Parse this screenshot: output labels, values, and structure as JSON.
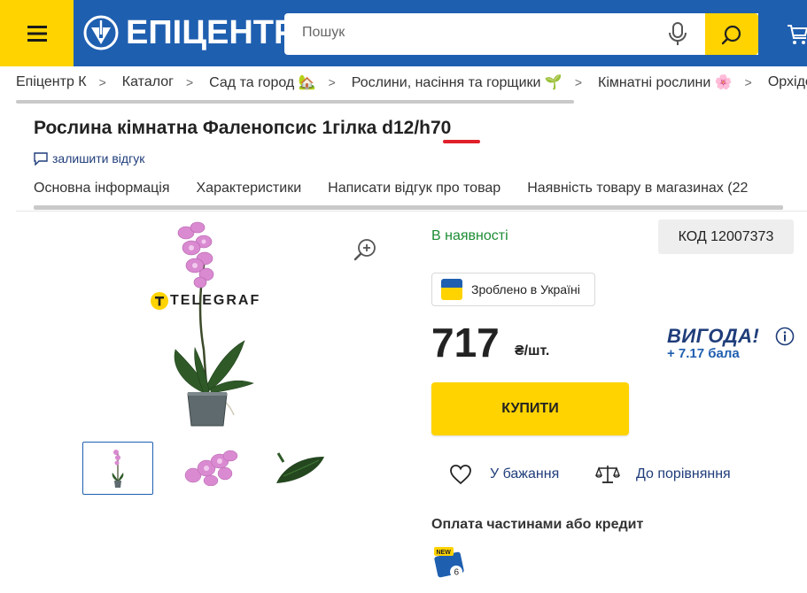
{
  "header": {
    "logo_text": "ЕПІЦЕНТР",
    "logo_reg": "®",
    "search_placeholder": "Пошук",
    "colors": {
      "brand_blue": "#1f5fb0",
      "brand_yellow": "#ffd300"
    },
    "icons": [
      "menu-icon",
      "logo-icon",
      "mic-icon",
      "search-icon",
      "cart-icon"
    ]
  },
  "breadcrumb": [
    {
      "label": "Епіцентр К"
    },
    {
      "label": "Каталог"
    },
    {
      "label": "Сад та город 🏡"
    },
    {
      "label": "Рослини, насіння та горщики 🌱"
    },
    {
      "label": "Кімнатні рослини 🌸"
    },
    {
      "label": "Орхідеї"
    }
  ],
  "product": {
    "title": "Рослина кімнатна Фаленопсис 1гілка d12/h70",
    "review_link": "залишити відгук",
    "tabs": [
      "Основна інформація",
      "Характеристики",
      "Написати відгук про товар",
      "Наявність товару в магазинах (22"
    ],
    "watermark": "TELEGRAF",
    "availability": "В наявності",
    "code": "КОД 12007373",
    "made_in": "Зроблено в Україні",
    "price": "717",
    "currency": "₴/шт.",
    "bonus_label": "ВИГОДА!",
    "bonus_points": "+ 7.17 бала",
    "buy_label": "КУПИТИ",
    "wishlist_label": "У бажання",
    "compare_label": "До порівняння",
    "credit_title": "Оплата частинами або кредит",
    "credit_badge_new": "NEW",
    "credit_badge_num": "6",
    "colors": {
      "in_stock": "#1e8c35",
      "link": "#1f3d7a",
      "highlight_underline": "#e0202a"
    }
  }
}
